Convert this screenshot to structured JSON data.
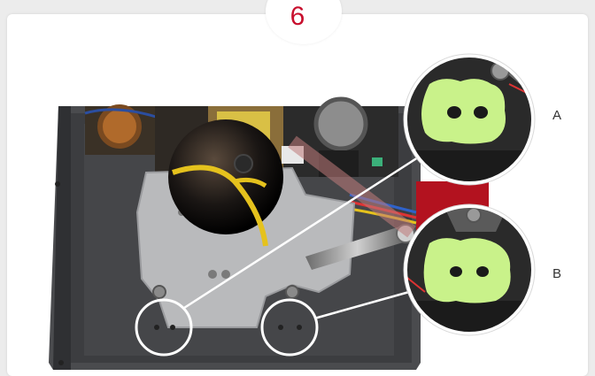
{
  "step": {
    "number": "6"
  },
  "callouts": [
    {
      "label": "A"
    },
    {
      "label": "B"
    }
  ],
  "colors": {
    "accent": "#c8102e",
    "battery": "#c9f28a",
    "housing": "#4a4b4e",
    "plate": "#b9babc"
  }
}
